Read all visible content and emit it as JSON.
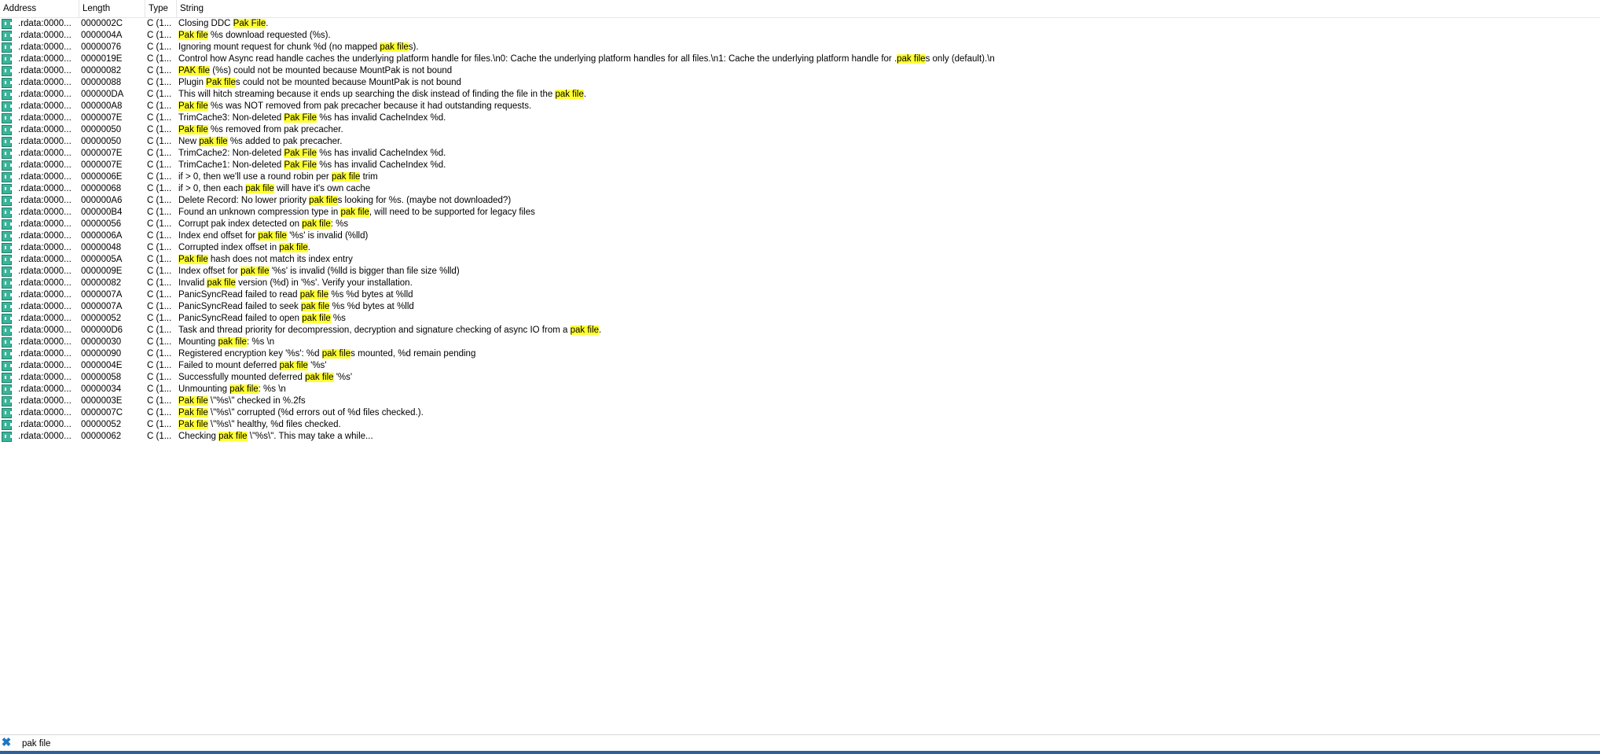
{
  "columns": [
    "Address",
    "Length",
    "Type",
    "String"
  ],
  "highlight_color": "#ffff33",
  "icon_name": "string-literal-icon",
  "rows": [
    {
      "address": ".rdata:0000...",
      "length": "0000002C",
      "type": "C (1...",
      "segments": [
        [
          "Closing DDC ",
          false
        ],
        [
          "Pak File",
          true
        ],
        [
          ".",
          false
        ]
      ]
    },
    {
      "address": ".rdata:0000...",
      "length": "0000004A",
      "type": "C (1...",
      "segments": [
        [
          "Pak file",
          true
        ],
        [
          " %s download requested (%s).",
          false
        ]
      ]
    },
    {
      "address": ".rdata:0000...",
      "length": "00000076",
      "type": "C (1...",
      "segments": [
        [
          "Ignoring mount request for chunk %d (no mapped ",
          false
        ],
        [
          "pak file",
          true
        ],
        [
          "s).",
          false
        ]
      ]
    },
    {
      "address": ".rdata:0000...",
      "length": "0000019E",
      "type": "C (1...",
      "segments": [
        [
          "Control how Async read handle caches the underlying platform handle for files.\\n0: Cache the underlying platform handles for all files.\\n1: Cache the underlying platform handle for .",
          false
        ],
        [
          "pak file",
          true
        ],
        [
          "s only (default).\\n",
          false
        ]
      ]
    },
    {
      "address": ".rdata:0000...",
      "length": "00000082",
      "type": "C (1...",
      "segments": [
        [
          "PAK file",
          true
        ],
        [
          " (%s) could not be mounted because MountPak is not bound",
          false
        ]
      ]
    },
    {
      "address": ".rdata:0000...",
      "length": "00000088",
      "type": "C (1...",
      "segments": [
        [
          "Plugin ",
          false
        ],
        [
          "Pak file",
          true
        ],
        [
          "s could not be mounted because MountPak is not bound",
          false
        ]
      ]
    },
    {
      "address": ".rdata:0000...",
      "length": "000000DA",
      "type": "C (1...",
      "segments": [
        [
          "This will hitch streaming because it ends up searching the disk instead of finding the file in the ",
          false
        ],
        [
          "pak file",
          true
        ],
        [
          ".",
          false
        ]
      ]
    },
    {
      "address": ".rdata:0000...",
      "length": "000000A8",
      "type": "C (1...",
      "segments": [
        [
          "Pak file",
          true
        ],
        [
          " %s was NOT removed from pak precacher because it had outstanding requests.",
          false
        ]
      ]
    },
    {
      "address": ".rdata:0000...",
      "length": "0000007E",
      "type": "C (1...",
      "segments": [
        [
          "TrimCache3: Non-deleted ",
          false
        ],
        [
          "Pak File",
          true
        ],
        [
          " %s has invalid CacheIndex %d.",
          false
        ]
      ]
    },
    {
      "address": ".rdata:0000...",
      "length": "00000050",
      "type": "C (1...",
      "segments": [
        [
          "Pak file",
          true
        ],
        [
          " %s removed from pak precacher.",
          false
        ]
      ]
    },
    {
      "address": ".rdata:0000...",
      "length": "00000050",
      "type": "C (1...",
      "segments": [
        [
          "New ",
          false
        ],
        [
          "pak file",
          true
        ],
        [
          " %s added to pak precacher.",
          false
        ]
      ]
    },
    {
      "address": ".rdata:0000...",
      "length": "0000007E",
      "type": "C (1...",
      "segments": [
        [
          "TrimCache2: Non-deleted ",
          false
        ],
        [
          "Pak File",
          true
        ],
        [
          " %s has invalid CacheIndex %d.",
          false
        ]
      ]
    },
    {
      "address": ".rdata:0000...",
      "length": "0000007E",
      "type": "C (1...",
      "segments": [
        [
          "TrimCache1: Non-deleted ",
          false
        ],
        [
          "Pak File",
          true
        ],
        [
          " %s has invalid CacheIndex %d.",
          false
        ]
      ]
    },
    {
      "address": ".rdata:0000...",
      "length": "0000006E",
      "type": "C (1...",
      "segments": [
        [
          "if > 0, then we'll use a round robin per ",
          false
        ],
        [
          "pak file",
          true
        ],
        [
          " trim",
          false
        ]
      ]
    },
    {
      "address": ".rdata:0000...",
      "length": "00000068",
      "type": "C (1...",
      "segments": [
        [
          "if > 0, then each ",
          false
        ],
        [
          "pak file",
          true
        ],
        [
          " will have it's own cache",
          false
        ]
      ]
    },
    {
      "address": ".rdata:0000...",
      "length": "000000A6",
      "type": "C (1...",
      "segments": [
        [
          "Delete Record: No lower priority ",
          false
        ],
        [
          "pak file",
          true
        ],
        [
          "s looking for %s. (maybe not downloaded?)",
          false
        ]
      ]
    },
    {
      "address": ".rdata:0000...",
      "length": "000000B4",
      "type": "C (1...",
      "segments": [
        [
          "Found an unknown compression type in ",
          false
        ],
        [
          "pak file",
          true
        ],
        [
          ", will need to be supported for legacy files",
          false
        ]
      ]
    },
    {
      "address": ".rdata:0000...",
      "length": "00000056",
      "type": "C (1...",
      "segments": [
        [
          "Corrupt pak index detected on ",
          false
        ],
        [
          "pak file",
          true
        ],
        [
          ": %s",
          false
        ]
      ]
    },
    {
      "address": ".rdata:0000...",
      "length": "0000006A",
      "type": "C (1...",
      "segments": [
        [
          "Index end offset for ",
          false
        ],
        [
          "pak file",
          true
        ],
        [
          " '%s' is invalid (%lld)",
          false
        ]
      ]
    },
    {
      "address": ".rdata:0000...",
      "length": "00000048",
      "type": "C (1...",
      "segments": [
        [
          "Corrupted index offset in ",
          false
        ],
        [
          "pak file",
          true
        ],
        [
          ".",
          false
        ]
      ]
    },
    {
      "address": ".rdata:0000...",
      "length": "0000005A",
      "type": "C (1...",
      "segments": [
        [
          "Pak file",
          true
        ],
        [
          " hash does not match its index entry",
          false
        ]
      ]
    },
    {
      "address": ".rdata:0000...",
      "length": "0000009E",
      "type": "C (1...",
      "segments": [
        [
          "Index offset for ",
          false
        ],
        [
          "pak file",
          true
        ],
        [
          " '%s' is invalid (%lld is bigger than file size %lld)",
          false
        ]
      ]
    },
    {
      "address": ".rdata:0000...",
      "length": "00000082",
      "type": "C (1...",
      "segments": [
        [
          "Invalid ",
          false
        ],
        [
          "pak file",
          true
        ],
        [
          " version (%d) in '%s'. Verify your installation.",
          false
        ]
      ]
    },
    {
      "address": ".rdata:0000...",
      "length": "0000007A",
      "type": "C (1...",
      "segments": [
        [
          "PanicSyncRead failed to read ",
          false
        ],
        [
          "pak file",
          true
        ],
        [
          " %s   %d bytes at %lld",
          false
        ]
      ]
    },
    {
      "address": ".rdata:0000...",
      "length": "0000007A",
      "type": "C (1...",
      "segments": [
        [
          "PanicSyncRead failed to seek ",
          false
        ],
        [
          "pak file",
          true
        ],
        [
          " %s   %d bytes at %lld",
          false
        ]
      ]
    },
    {
      "address": ".rdata:0000...",
      "length": "00000052",
      "type": "C (1...",
      "segments": [
        [
          "PanicSyncRead failed to open ",
          false
        ],
        [
          "pak file",
          true
        ],
        [
          " %s",
          false
        ]
      ]
    },
    {
      "address": ".rdata:0000...",
      "length": "000000D6",
      "type": "C (1...",
      "segments": [
        [
          "Task and thread priority for decompression, decryption and signature checking of async IO from a ",
          false
        ],
        [
          "pak file",
          true
        ],
        [
          ".",
          false
        ]
      ]
    },
    {
      "address": ".rdata:0000...",
      "length": "00000030",
      "type": "C (1...",
      "segments": [
        [
          "Mounting ",
          false
        ],
        [
          "pak file",
          true
        ],
        [
          ": %s \\n",
          false
        ]
      ]
    },
    {
      "address": ".rdata:0000...",
      "length": "00000090",
      "type": "C (1...",
      "segments": [
        [
          "Registered encryption key '%s': %d ",
          false
        ],
        [
          "pak file",
          true
        ],
        [
          "s mounted, %d remain pending",
          false
        ]
      ]
    },
    {
      "address": ".rdata:0000...",
      "length": "0000004E",
      "type": "C (1...",
      "segments": [
        [
          "Failed to mount deferred ",
          false
        ],
        [
          "pak file",
          true
        ],
        [
          " '%s'",
          false
        ]
      ]
    },
    {
      "address": ".rdata:0000...",
      "length": "00000058",
      "type": "C (1...",
      "segments": [
        [
          "Successfully mounted deferred ",
          false
        ],
        [
          "pak file",
          true
        ],
        [
          " '%s'",
          false
        ]
      ]
    },
    {
      "address": ".rdata:0000...",
      "length": "00000034",
      "type": "C (1...",
      "segments": [
        [
          "Unmounting ",
          false
        ],
        [
          "pak file",
          true
        ],
        [
          ": %s \\n",
          false
        ]
      ]
    },
    {
      "address": ".rdata:0000...",
      "length": "0000003E",
      "type": "C (1...",
      "segments": [
        [
          "Pak file",
          true
        ],
        [
          " \\\"%s\\\" checked in %.2fs",
          false
        ]
      ]
    },
    {
      "address": ".rdata:0000...",
      "length": "0000007C",
      "type": "C (1...",
      "segments": [
        [
          "Pak file",
          true
        ],
        [
          " \\\"%s\\\" corrupted (%d errors out of %d files checked.).",
          false
        ]
      ]
    },
    {
      "address": ".rdata:0000...",
      "length": "00000052",
      "type": "C (1...",
      "segments": [
        [
          "Pak file",
          true
        ],
        [
          " \\\"%s\\\" healthy, %d files checked.",
          false
        ]
      ]
    },
    {
      "address": ".rdata:0000...",
      "length": "00000062",
      "type": "C (1...",
      "segments": [
        [
          "Checking ",
          false
        ],
        [
          "pak file",
          true
        ],
        [
          " \\\"%s\\\". This may take a while...",
          false
        ]
      ]
    }
  ],
  "search": {
    "value": "pak file"
  }
}
